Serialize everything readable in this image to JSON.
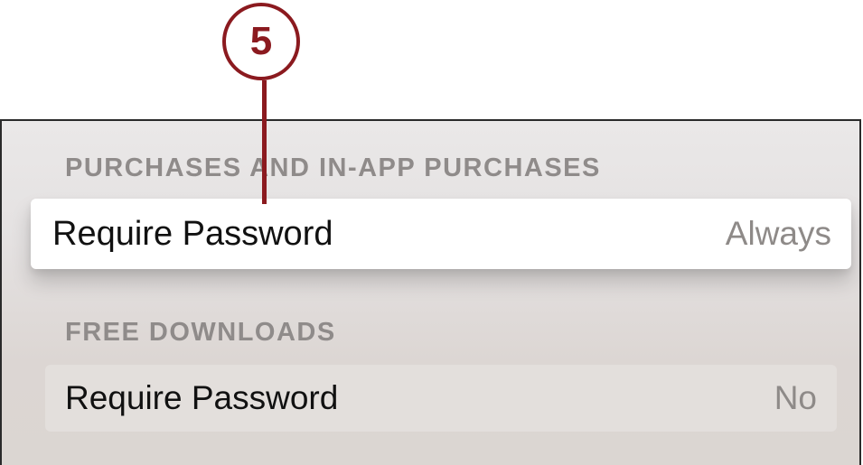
{
  "callout": {
    "number": "5"
  },
  "sections": [
    {
      "header": "PURCHASES AND IN-APP PURCHASES",
      "row": {
        "label": "Require Password",
        "value": "Always",
        "focused": true
      }
    },
    {
      "header": "FREE DOWNLOADS",
      "row": {
        "label": "Require Password",
        "value": "No",
        "focused": false
      }
    }
  ],
  "colors": {
    "callout": "#8b1a1f",
    "header_text": "#8f8b8a",
    "value_text": "#8e8a88",
    "label_text": "#111111"
  }
}
